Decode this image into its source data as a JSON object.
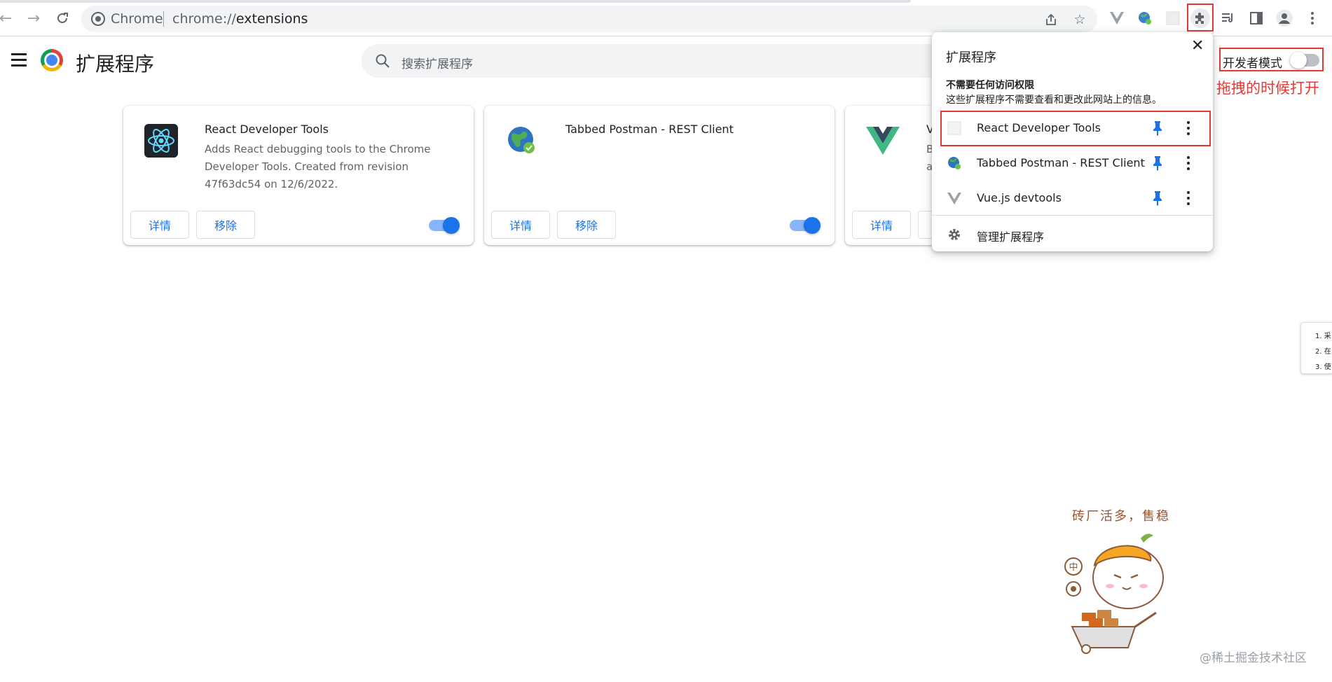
{
  "browser": {
    "site_chip": "Chrome",
    "url_scheme": "chrome://",
    "url_host": "extensions"
  },
  "page": {
    "title": "扩展程序",
    "search_placeholder": "搜索扩展程序",
    "dev_mode_label": "开发者模式",
    "dev_mode_enabled": false,
    "annotation": "拖拽的时候打开"
  },
  "extensions": [
    {
      "name": "React Developer Tools",
      "description": "Adds React debugging tools to the Chrome Developer Tools. Created from revision 47f63dc54 on 12/6/2022.",
      "details_label": "详情",
      "remove_label": "移除",
      "enabled": true
    },
    {
      "name": "Tabbed Postman - REST Client",
      "description": "",
      "details_label": "详情",
      "remove_label": "移除",
      "enabled": true
    },
    {
      "name": "V",
      "description_lines": [
        "B",
        "a"
      ],
      "details_label": "详情",
      "remove_label": "",
      "enabled": true
    }
  ],
  "popup": {
    "title": "扩展程序",
    "close_glyph": "✕",
    "section_heading": "不需要任何访问权限",
    "section_desc": "这些扩展程序不需要查看和更改此网站上的信息。",
    "items": [
      {
        "label": "React Developer Tools",
        "icon": "react-placeholder-icon",
        "pinned": true
      },
      {
        "label": "Tabbed Postman - REST Client",
        "icon": "globe-icon",
        "pinned": true
      },
      {
        "label": "Vue.js devtools",
        "icon": "vue-icon",
        "pinned": true
      }
    ],
    "manage_label": "管理扩展程序"
  },
  "edge_widget": {
    "items": [
      "1. 采",
      "2. 在",
      "3. 使"
    ]
  },
  "sticker": {
    "caption": "砖厂活多，售稳",
    "badge_char": "中"
  },
  "watermark": "@稀土掘金技术社区",
  "colors": {
    "accent": "#1a73e8",
    "highlight": "#e53935",
    "vue_green": "#41b883",
    "vue_dark": "#35495e"
  }
}
